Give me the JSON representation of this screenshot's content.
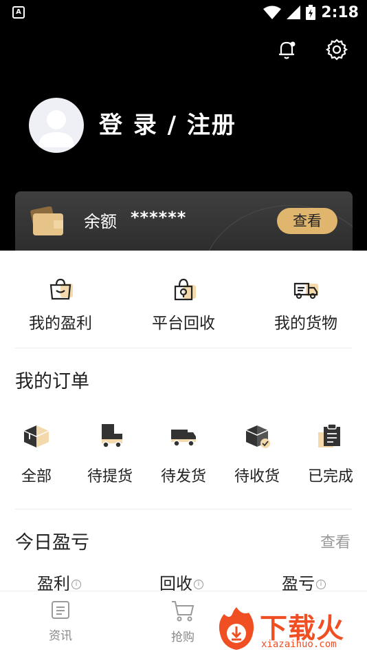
{
  "status_bar": {
    "time": "2:18",
    "left_icon": "A"
  },
  "header": {
    "icons": [
      "bell-icon",
      "gear-icon"
    ],
    "login_text": "登 录 / 注册"
  },
  "balance": {
    "label": "余额",
    "value": "******",
    "button": "查看"
  },
  "quick": [
    {
      "label": "我的盈利",
      "icon": "profit-bag-icon"
    },
    {
      "label": "平台回收",
      "icon": "recycle-bag-icon"
    },
    {
      "label": "我的货物",
      "icon": "truck-goods-icon"
    }
  ],
  "orders": {
    "title": "我的订单",
    "items": [
      {
        "label": "全部",
        "icon": "box-icon"
      },
      {
        "label": "待提货",
        "icon": "pickup-truck-icon"
      },
      {
        "label": "待发货",
        "icon": "shipping-truck-icon"
      },
      {
        "label": "待收货",
        "icon": "receive-box-icon"
      },
      {
        "label": "已完成",
        "icon": "clipboard-done-icon"
      }
    ]
  },
  "today": {
    "title": "今日盈亏",
    "more": "查看",
    "items": [
      "盈利",
      "回收",
      "盈亏"
    ]
  },
  "bottom_nav": [
    {
      "label": "资讯",
      "icon": "news-icon"
    },
    {
      "label": "抢购",
      "icon": "cart-icon"
    }
  ],
  "watermark": {
    "text": "下载火",
    "url": "xiazaihuo.com"
  },
  "colors": {
    "accent": "#e0b56e",
    "header_bg": "#000000",
    "watermark": "#f04e23"
  }
}
